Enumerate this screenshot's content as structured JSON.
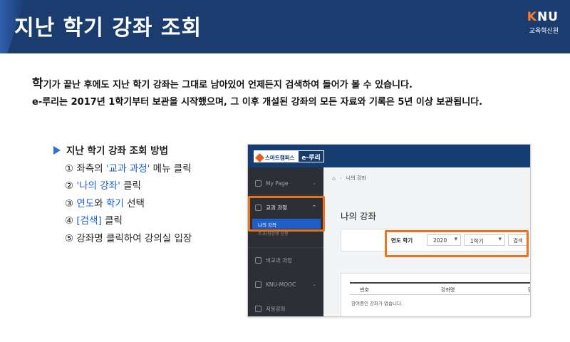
{
  "header": {
    "title": "지난 학기 강좌 조회",
    "logo": {
      "k": "K",
      "rest": "NU",
      "sub": "교육혁신원"
    }
  },
  "intro": {
    "line1_big": "학",
    "line1_rest": "기가 끝난 후에도 지난 학기 강좌는 그대로 남아있어 언제든지 검색하여 들어가 볼 수 있습니다.",
    "line2": "e-루리는 2017년 1학기부터 보관을 시작했으며, 그 이후 개설된 강좌의 모든 자료와 기록은 5년 이상 보관됩니다."
  },
  "steps": {
    "heading": "지난 학기 강좌 조회 방법",
    "step1": {
      "pre": "① 좌측의 ",
      "hl": "'교과 과정'",
      "post": " 메뉴 클릭"
    },
    "step2": {
      "pre": "② ",
      "hl": "'나의 강좌'",
      "post": " 클릭"
    },
    "step3": {
      "pre": "③ ",
      "hl1": "연도",
      "mid": "와 ",
      "hl2": "학기",
      "post": " 선택"
    },
    "step4": {
      "pre": "④ ",
      "hl": "[검색]",
      "post": " 클릭"
    },
    "step5": {
      "text": "⑤ 강좌명 클릭하여 강의실 입장"
    }
  },
  "screenshot": {
    "brand": {
      "smart": "스마트캠퍼스",
      "eruri": "e-루리"
    },
    "sidebar": {
      "mypage": "My Page",
      "curriculum": "교과 과정",
      "my_courses": "나의 강좌",
      "inquiry": "조교/청강생 신청",
      "noncurriculum": "비교과 과정",
      "mooc": "KNU-MOOC",
      "books": "저용강좌"
    },
    "breadcrumb": "나의 강좌",
    "main_title": "나의 강좌",
    "filter": {
      "label": "연도 학기",
      "year": "2020",
      "semester": "1학기",
      "search": "검색"
    },
    "table": {
      "col_no": "번호",
      "col_name": "강좌명",
      "col_more": "담",
      "empty": "참여중인 강좌가 없습니다."
    }
  },
  "colors": {
    "header_bg": "#1a3c6e",
    "highlight": "#1d5fd1",
    "callout": "#e8741e",
    "topbar": "#153d72",
    "sidebar": "#2c2f35"
  }
}
